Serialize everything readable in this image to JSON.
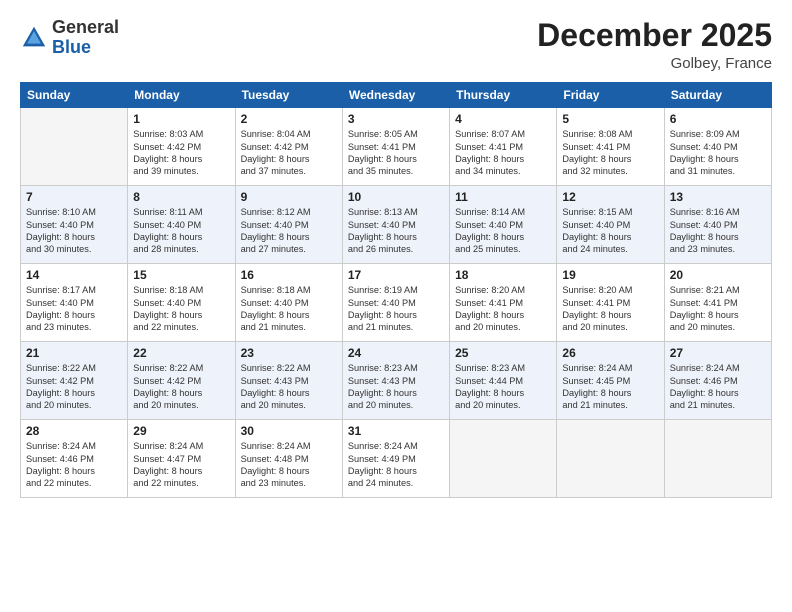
{
  "header": {
    "logo_general": "General",
    "logo_blue": "Blue",
    "month_title": "December 2025",
    "location": "Golbey, France"
  },
  "days_of_week": [
    "Sunday",
    "Monday",
    "Tuesday",
    "Wednesday",
    "Thursday",
    "Friday",
    "Saturday"
  ],
  "weeks": [
    {
      "stripe": false,
      "days": [
        {
          "num": "",
          "info": ""
        },
        {
          "num": "1",
          "info": "Sunrise: 8:03 AM\nSunset: 4:42 PM\nDaylight: 8 hours\nand 39 minutes."
        },
        {
          "num": "2",
          "info": "Sunrise: 8:04 AM\nSunset: 4:42 PM\nDaylight: 8 hours\nand 37 minutes."
        },
        {
          "num": "3",
          "info": "Sunrise: 8:05 AM\nSunset: 4:41 PM\nDaylight: 8 hours\nand 35 minutes."
        },
        {
          "num": "4",
          "info": "Sunrise: 8:07 AM\nSunset: 4:41 PM\nDaylight: 8 hours\nand 34 minutes."
        },
        {
          "num": "5",
          "info": "Sunrise: 8:08 AM\nSunset: 4:41 PM\nDaylight: 8 hours\nand 32 minutes."
        },
        {
          "num": "6",
          "info": "Sunrise: 8:09 AM\nSunset: 4:40 PM\nDaylight: 8 hours\nand 31 minutes."
        }
      ]
    },
    {
      "stripe": true,
      "days": [
        {
          "num": "7",
          "info": "Sunrise: 8:10 AM\nSunset: 4:40 PM\nDaylight: 8 hours\nand 30 minutes."
        },
        {
          "num": "8",
          "info": "Sunrise: 8:11 AM\nSunset: 4:40 PM\nDaylight: 8 hours\nand 28 minutes."
        },
        {
          "num": "9",
          "info": "Sunrise: 8:12 AM\nSunset: 4:40 PM\nDaylight: 8 hours\nand 27 minutes."
        },
        {
          "num": "10",
          "info": "Sunrise: 8:13 AM\nSunset: 4:40 PM\nDaylight: 8 hours\nand 26 minutes."
        },
        {
          "num": "11",
          "info": "Sunrise: 8:14 AM\nSunset: 4:40 PM\nDaylight: 8 hours\nand 25 minutes."
        },
        {
          "num": "12",
          "info": "Sunrise: 8:15 AM\nSunset: 4:40 PM\nDaylight: 8 hours\nand 24 minutes."
        },
        {
          "num": "13",
          "info": "Sunrise: 8:16 AM\nSunset: 4:40 PM\nDaylight: 8 hours\nand 23 minutes."
        }
      ]
    },
    {
      "stripe": false,
      "days": [
        {
          "num": "14",
          "info": "Sunrise: 8:17 AM\nSunset: 4:40 PM\nDaylight: 8 hours\nand 23 minutes."
        },
        {
          "num": "15",
          "info": "Sunrise: 8:18 AM\nSunset: 4:40 PM\nDaylight: 8 hours\nand 22 minutes."
        },
        {
          "num": "16",
          "info": "Sunrise: 8:18 AM\nSunset: 4:40 PM\nDaylight: 8 hours\nand 21 minutes."
        },
        {
          "num": "17",
          "info": "Sunrise: 8:19 AM\nSunset: 4:40 PM\nDaylight: 8 hours\nand 21 minutes."
        },
        {
          "num": "18",
          "info": "Sunrise: 8:20 AM\nSunset: 4:41 PM\nDaylight: 8 hours\nand 20 minutes."
        },
        {
          "num": "19",
          "info": "Sunrise: 8:20 AM\nSunset: 4:41 PM\nDaylight: 8 hours\nand 20 minutes."
        },
        {
          "num": "20",
          "info": "Sunrise: 8:21 AM\nSunset: 4:41 PM\nDaylight: 8 hours\nand 20 minutes."
        }
      ]
    },
    {
      "stripe": true,
      "days": [
        {
          "num": "21",
          "info": "Sunrise: 8:22 AM\nSunset: 4:42 PM\nDaylight: 8 hours\nand 20 minutes."
        },
        {
          "num": "22",
          "info": "Sunrise: 8:22 AM\nSunset: 4:42 PM\nDaylight: 8 hours\nand 20 minutes."
        },
        {
          "num": "23",
          "info": "Sunrise: 8:22 AM\nSunset: 4:43 PM\nDaylight: 8 hours\nand 20 minutes."
        },
        {
          "num": "24",
          "info": "Sunrise: 8:23 AM\nSunset: 4:43 PM\nDaylight: 8 hours\nand 20 minutes."
        },
        {
          "num": "25",
          "info": "Sunrise: 8:23 AM\nSunset: 4:44 PM\nDaylight: 8 hours\nand 20 minutes."
        },
        {
          "num": "26",
          "info": "Sunrise: 8:24 AM\nSunset: 4:45 PM\nDaylight: 8 hours\nand 21 minutes."
        },
        {
          "num": "27",
          "info": "Sunrise: 8:24 AM\nSunset: 4:46 PM\nDaylight: 8 hours\nand 21 minutes."
        }
      ]
    },
    {
      "stripe": false,
      "days": [
        {
          "num": "28",
          "info": "Sunrise: 8:24 AM\nSunset: 4:46 PM\nDaylight: 8 hours\nand 22 minutes."
        },
        {
          "num": "29",
          "info": "Sunrise: 8:24 AM\nSunset: 4:47 PM\nDaylight: 8 hours\nand 22 minutes."
        },
        {
          "num": "30",
          "info": "Sunrise: 8:24 AM\nSunset: 4:48 PM\nDaylight: 8 hours\nand 23 minutes."
        },
        {
          "num": "31",
          "info": "Sunrise: 8:24 AM\nSunset: 4:49 PM\nDaylight: 8 hours\nand 24 minutes."
        },
        {
          "num": "",
          "info": ""
        },
        {
          "num": "",
          "info": ""
        },
        {
          "num": "",
          "info": ""
        }
      ]
    }
  ]
}
